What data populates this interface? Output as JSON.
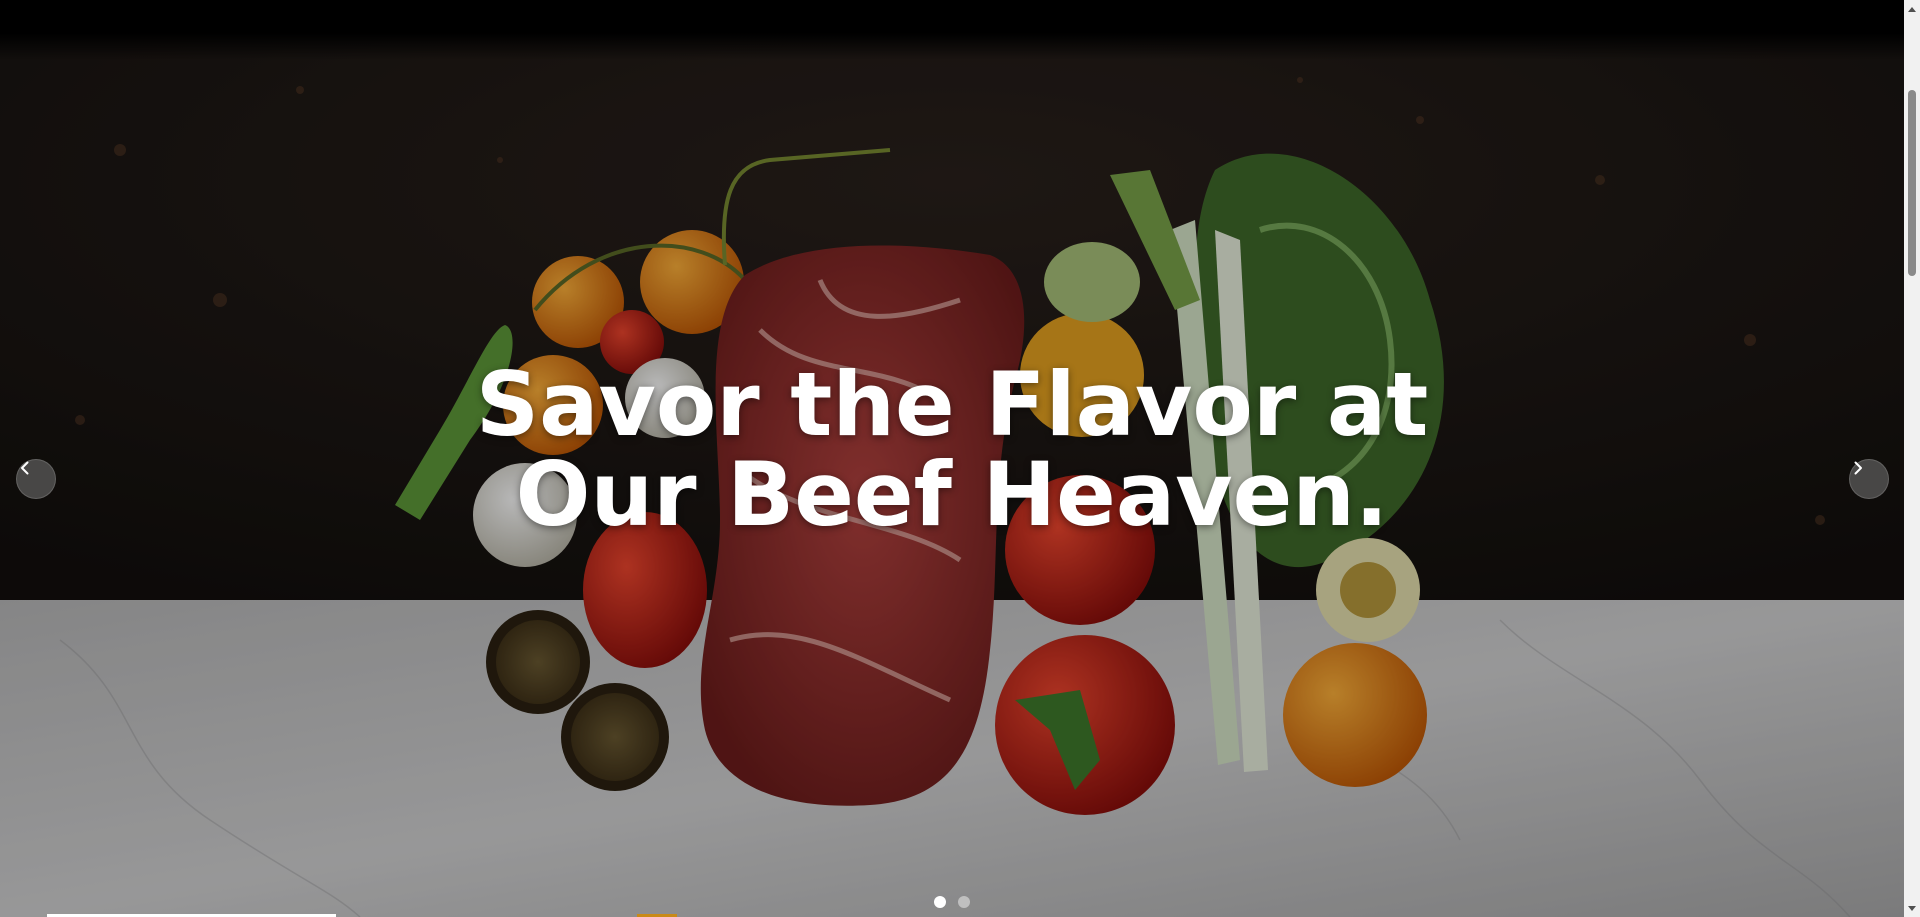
{
  "hero": {
    "headline_line1": "Savor the Flavor at",
    "headline_line2": "Our Beef Heaven."
  },
  "carousel": {
    "prev_icon": "chevron-left-icon",
    "next_icon": "chevron-right-icon",
    "slide_count": 2,
    "active_slide": 1
  },
  "colors": {
    "headline": "#ffffff",
    "dark_counter": "#1a1512",
    "marble": "#c9c9c9",
    "accent": "#c98a18"
  }
}
